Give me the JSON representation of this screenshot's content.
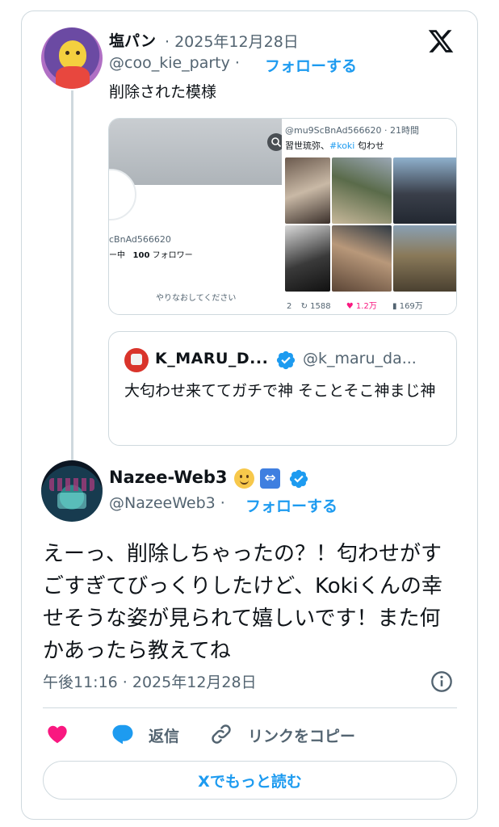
{
  "brand": {
    "accent": "#1d9bf0",
    "heart": "#f91880",
    "border": "#cfd9de",
    "muted": "#536471"
  },
  "parent_tweet": {
    "author_name": "塩パン",
    "date_sep": "· 2025年12月28日",
    "handle": "@coo_kie_party ·",
    "follow_label": "フォローする",
    "text": "削除された模様",
    "avatar_icon": "character-avatar"
  },
  "embedded_media": {
    "left": {
      "handle": "cBnAd566620",
      "stats_prefix": "ー中",
      "followers_count": "100",
      "followers_label": "フォロワー",
      "retry": "やりなおしてください"
    },
    "right": {
      "header": "@mu9ScBnAd566620 · 21時間",
      "text_prefix": "習世琉弥、",
      "tag": "#koki",
      "text_suffix": " 匂わせ",
      "stats": {
        "reply": "2",
        "retweet": "1588",
        "likes": "1.2万",
        "views": "169万"
      }
    }
  },
  "quoted_tweet": {
    "name": "K_MARU_D...",
    "handle": "@k_maru_da...",
    "text": "大匂わせ来ててガチで神 そことそこ神まじ神"
  },
  "main_tweet": {
    "author_name": "Nazee-Web3",
    "emoji_arrows": "⇔",
    "handle": "@NazeeWeb3 ·",
    "follow_label": "フォローする",
    "text": "えーっ、削除しちゃったの？！匂わせがすごすぎてびっくりしたけど、Kokiくんの幸せそうな姿が見られて嬉しいです！また何かあったら教えてね",
    "timestamp": "午後11:16 · 2025年12月28日"
  },
  "actions": {
    "reply_label": "返信",
    "copy_link_label": "リンクをコピー",
    "read_more_label": "Xでもっと読む"
  }
}
